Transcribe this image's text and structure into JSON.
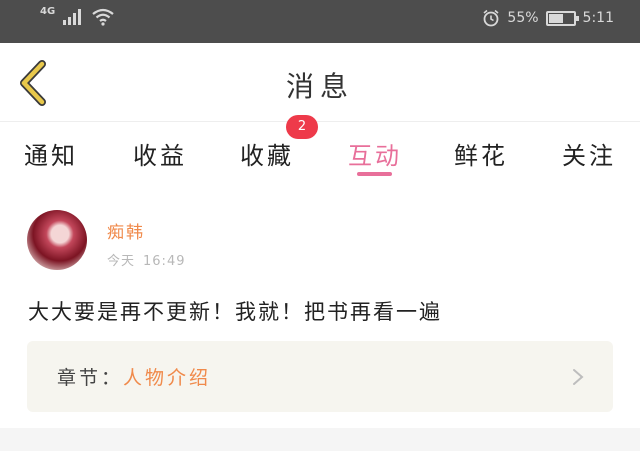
{
  "status_bar": {
    "network": "4G",
    "battery_percent": "55%",
    "time": "5:11"
  },
  "header": {
    "title": "消息"
  },
  "tabs": [
    {
      "label": "通知"
    },
    {
      "label": "收益"
    },
    {
      "label": "收藏"
    },
    {
      "label": "互动"
    },
    {
      "label": "鲜花"
    },
    {
      "label": "关注"
    }
  ],
  "active_tab": "互动",
  "badge_count": "2",
  "message": {
    "username": "痴韩",
    "date": "今天",
    "time": "16:49",
    "content": "大大要是再不更新！我就！把书再看一遍",
    "chapter_prefix": "章节：",
    "chapter_name": "人物介绍"
  },
  "colors": {
    "accent_pink": "#e86f9a",
    "accent_orange": "#f08a4b",
    "badge_red": "#ee3a4a",
    "back_arrow_yellow": "#e8c84b"
  }
}
